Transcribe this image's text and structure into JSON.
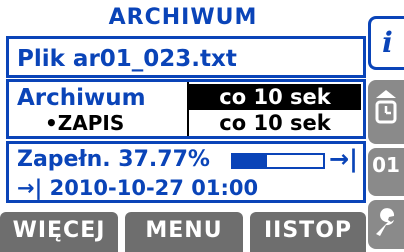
{
  "title": "ARCHIWUM",
  "file": {
    "label": "Plik ar01_023.txt"
  },
  "archive": {
    "label": "Archiwum",
    "state": "•ZAPIS",
    "options": {
      "selected": "co 10 sek",
      "other": "co 10 sek"
    }
  },
  "progress": {
    "label": "Zapełn. 37.77%",
    "fraction": 0.3777,
    "date": "→| 2010-10-27 01:00",
    "end_icon": "→|"
  },
  "softkeys": {
    "left": "WIĘCEJ",
    "middle": "MENU",
    "right": "IISTOP"
  },
  "side_buttons": {
    "info_glyph": "i",
    "number_label": "01",
    "icons": [
      "info-icon",
      "clock-icon",
      "number-icon",
      "wrench-icon"
    ]
  },
  "colors": {
    "accent": "#0a44b8",
    "softkey_bg": "#6e6e6e",
    "highlight": "#000000"
  }
}
